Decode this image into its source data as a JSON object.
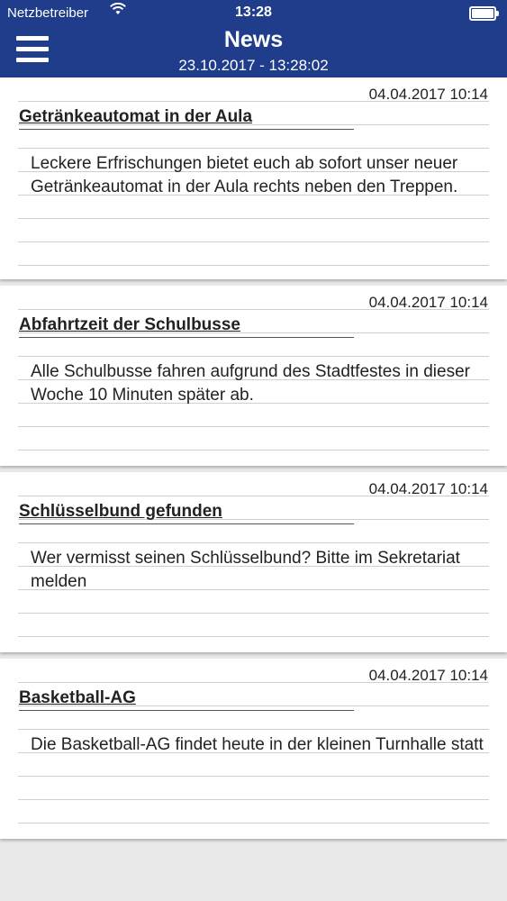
{
  "status_bar": {
    "carrier": "Netzbetreiber",
    "time": "13:28",
    "wifi_icon": "wifi-icon",
    "battery_icon": "battery-icon"
  },
  "nav": {
    "title": "News",
    "subtitle": "23.10.2017 - 13:28:02",
    "menu_icon": "hamburger-menu-icon"
  },
  "colors": {
    "header": "#1f3d8a",
    "background": "#e9e9e9",
    "card": "#ffffff"
  },
  "news": [
    {
      "date": "04.04.2017 10:14",
      "title": "Getränkeautomat in der Aula",
      "body": "Leckere Erfrischungen bietet euch ab sofort unser neuer Getränkeautomat in der Aula rechts neben den Treppen."
    },
    {
      "date": "04.04.2017 10:14",
      "title": "Abfahrtzeit der Schulbusse",
      "body": "Alle Schulbusse fahren aufgrund des Stadtfestes in dieser Woche 10 Minuten später ab."
    },
    {
      "date": "04.04.2017 10:14",
      "title": "Schlüsselbund gefunden",
      "body": "Wer vermisst seinen Schlüsselbund? Bitte im Sekretariat melden"
    },
    {
      "date": "04.04.2017 10:14",
      "title": "Basketball-AG",
      "body": "Die Basketball-AG findet heute in der kleinen Turnhalle statt"
    }
  ]
}
